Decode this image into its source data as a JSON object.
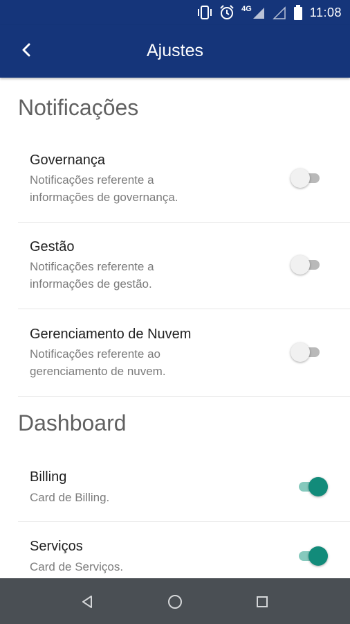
{
  "status_bar": {
    "time": "11:08",
    "network": "4G",
    "icons": [
      "vibrate-icon",
      "alarm-icon",
      "signal-icon",
      "signal-empty-icon",
      "battery-icon"
    ]
  },
  "app_bar": {
    "title": "Ajustes",
    "back_icon": "chevron-left-icon"
  },
  "sections": [
    {
      "header": "Notificações",
      "items": [
        {
          "title": "Governança",
          "desc1": "Notificações referente a",
          "desc2": "informações de governança.",
          "enabled": false
        },
        {
          "title": "Gestão",
          "desc1": "Notificações referente a",
          "desc2": "informações de gestão.",
          "enabled": false
        },
        {
          "title": "Gerenciamento de Nuvem",
          "desc1": "Notificações referente ao",
          "desc2": "gerenciamento de nuvem.",
          "enabled": false
        }
      ]
    },
    {
      "header": "Dashboard",
      "items": [
        {
          "title": "Billing",
          "desc1": "Card de Billing.",
          "enabled": true
        },
        {
          "title": "Serviços",
          "desc1": "Card de Serviços.",
          "enabled": true
        }
      ]
    }
  ],
  "colors": {
    "app_bar": "#15357a",
    "accent": "#128b7a",
    "nav_bar": "#4a4f54"
  },
  "nav_bar": {
    "icons": [
      "back-triangle-icon",
      "home-circle-icon",
      "recents-square-icon"
    ]
  }
}
